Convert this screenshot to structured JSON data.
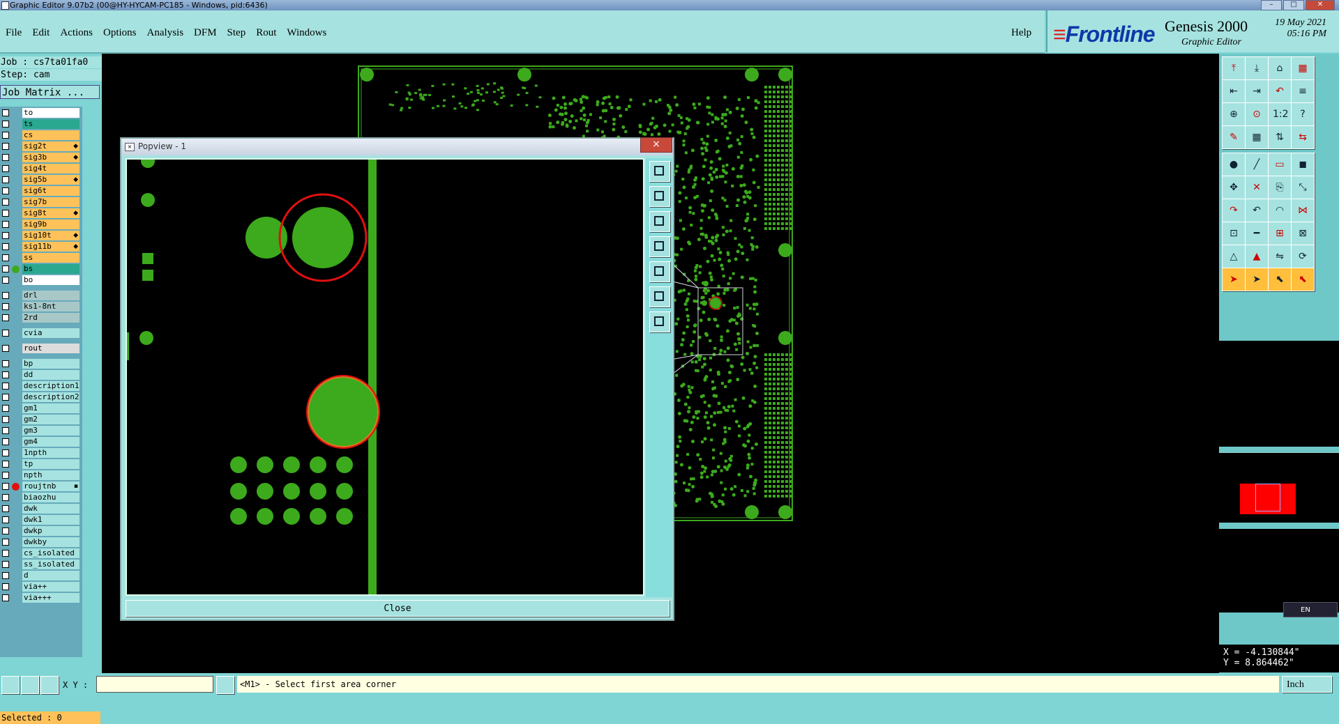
{
  "window": {
    "title": "Graphic Editor 9.07b2 (00@HY-HYCAM-PC185 - Windows, pid:6436)"
  },
  "menu": [
    "File",
    "Edit",
    "Actions",
    "Options",
    "Analysis",
    "DFM",
    "Step",
    "Rout",
    "Windows"
  ],
  "help_label": "Help",
  "brand": {
    "logo": "Frontline",
    "product": "Genesis 2000",
    "subtitle": "Graphic Editor",
    "date": "19 May 2021",
    "time": "05:16 PM"
  },
  "job": {
    "job_line": "Job : cs7ta01fa0",
    "step_line": "Step: cam",
    "matrix_button": "Job Matrix ..."
  },
  "layers": [
    {
      "name": "to",
      "color": "#ffffff",
      "dot": null,
      "mark": ""
    },
    {
      "name": "ts",
      "color": "#2aa890",
      "dot": null,
      "mark": ""
    },
    {
      "name": "cs",
      "color": "#ffc25a",
      "dot": null,
      "mark": ""
    },
    {
      "name": "sig2t",
      "color": "#ffc25a",
      "dot": null,
      "mark": "◆"
    },
    {
      "name": "sig3b",
      "color": "#ffc25a",
      "dot": null,
      "mark": "◆"
    },
    {
      "name": "sig4t",
      "color": "#ffc25a",
      "dot": null,
      "mark": ""
    },
    {
      "name": "sig5b",
      "color": "#ffc25a",
      "dot": null,
      "mark": "◆"
    },
    {
      "name": "sig6t",
      "color": "#ffc25a",
      "dot": null,
      "mark": ""
    },
    {
      "name": "sig7b",
      "color": "#ffc25a",
      "dot": null,
      "mark": ""
    },
    {
      "name": "sig8t",
      "color": "#ffc25a",
      "dot": null,
      "mark": "◆"
    },
    {
      "name": "sig9b",
      "color": "#ffc25a",
      "dot": null,
      "mark": ""
    },
    {
      "name": "sig10t",
      "color": "#ffc25a",
      "dot": null,
      "mark": "◆"
    },
    {
      "name": "sig11b",
      "color": "#ffc25a",
      "dot": null,
      "mark": "◆"
    },
    {
      "name": "ss",
      "color": "#ffc25a",
      "dot": null,
      "mark": ""
    },
    {
      "name": "bs",
      "color": "#2aa890",
      "dot": "#3caa1c",
      "mark": ""
    },
    {
      "name": "bo",
      "color": "#ffffff",
      "dot": null,
      "mark": ""
    },
    {
      "name": "drl",
      "color": "#a8c8c8",
      "dot": null,
      "mark": ""
    },
    {
      "name": "ks1-8nt",
      "color": "#a8c8c8",
      "dot": null,
      "mark": ""
    },
    {
      "name": "2rd",
      "color": "#a8c8c8",
      "dot": null,
      "mark": ""
    },
    {
      "name": "cvia",
      "color": "#a6e3e0",
      "dot": null,
      "mark": ""
    },
    {
      "name": "rout",
      "color": "#dcdcdc",
      "dot": null,
      "mark": ""
    },
    {
      "name": "bp",
      "color": "#a6e3e0",
      "dot": null,
      "mark": ""
    },
    {
      "name": "dd",
      "color": "#a6e3e0",
      "dot": null,
      "mark": ""
    },
    {
      "name": "description1",
      "color": "#a6e3e0",
      "dot": null,
      "mark": ""
    },
    {
      "name": "description2",
      "color": "#a6e3e0",
      "dot": null,
      "mark": ""
    },
    {
      "name": "gm1",
      "color": "#a6e3e0",
      "dot": null,
      "mark": ""
    },
    {
      "name": "gm2",
      "color": "#a6e3e0",
      "dot": null,
      "mark": ""
    },
    {
      "name": "gm3",
      "color": "#a6e3e0",
      "dot": null,
      "mark": ""
    },
    {
      "name": "gm4",
      "color": "#a6e3e0",
      "dot": null,
      "mark": ""
    },
    {
      "name": "1npth",
      "color": "#a6e3e0",
      "dot": null,
      "mark": ""
    },
    {
      "name": "tp",
      "color": "#a6e3e0",
      "dot": null,
      "mark": ""
    },
    {
      "name": "npth",
      "color": "#a6e3e0",
      "dot": null,
      "mark": ""
    },
    {
      "name": "roujtnb",
      "color": "#a6e3e0",
      "dot": "#e01010",
      "mark": "▪"
    },
    {
      "name": "biaozhu",
      "color": "#a6e3e0",
      "dot": null,
      "mark": ""
    },
    {
      "name": "dwk",
      "color": "#a6e3e0",
      "dot": null,
      "mark": ""
    },
    {
      "name": "dwk1",
      "color": "#a6e3e0",
      "dot": null,
      "mark": ""
    },
    {
      "name": "dwkp",
      "color": "#a6e3e0",
      "dot": null,
      "mark": ""
    },
    {
      "name": "dwkby",
      "color": "#a6e3e0",
      "dot": null,
      "mark": ""
    },
    {
      "name": "cs_isolated",
      "color": "#a6e3e0",
      "dot": null,
      "mark": ""
    },
    {
      "name": "ss_isolated",
      "color": "#a6e3e0",
      "dot": null,
      "mark": ""
    },
    {
      "name": "d",
      "color": "#a6e3e0",
      "dot": null,
      "mark": ""
    },
    {
      "name": "via++",
      "color": "#a6e3e0",
      "dot": null,
      "mark": ""
    },
    {
      "name": "via+++",
      "color": "#a6e3e0",
      "dot": null,
      "mark": ""
    }
  ],
  "selected_text": "Selected : 0",
  "popview": {
    "title": "Popview - 1",
    "close_label": "Close",
    "close_x": "×"
  },
  "status": {
    "xy_label": "X Y :",
    "xy_value": "",
    "message": "<M1> - Select first area corner",
    "units": "Inch"
  },
  "coordinates": {
    "x": "X = -4.130844\"",
    "y": "Y = 8.864462\""
  },
  "ime": {
    "label": "EN"
  },
  "colors": {
    "board": "#3caa1c",
    "highlight": "#e01010",
    "background": "#000000",
    "panel": "#a6e3e0"
  }
}
